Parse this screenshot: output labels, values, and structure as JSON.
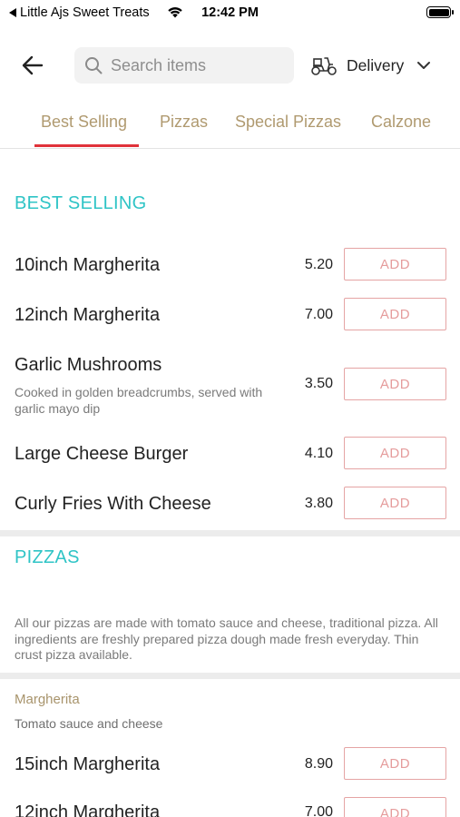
{
  "status_bar": {
    "back_app": "Little Ajs Sweet Treats",
    "time": "12:42 PM"
  },
  "header": {
    "search_placeholder": "Search items",
    "delivery_label": "Delivery"
  },
  "tabs": [
    {
      "label": "Best Selling",
      "active": true
    },
    {
      "label": "Pizzas",
      "active": false
    },
    {
      "label": "Special Pizzas",
      "active": false
    },
    {
      "label": "Calzone",
      "active": false
    }
  ],
  "best_selling": {
    "title": "BEST SELLING",
    "items": [
      {
        "name": "10inch Margherita",
        "price": "5.20",
        "add_label": "ADD"
      },
      {
        "name": "12inch Margherita",
        "price": "7.00",
        "add_label": "ADD"
      },
      {
        "name": "Garlic Mushrooms",
        "description": "Cooked in golden breadcrumbs, served with garlic mayo dip",
        "price": "3.50",
        "add_label": "ADD"
      },
      {
        "name": "Large Cheese Burger",
        "price": "4.10",
        "add_label": "ADD"
      },
      {
        "name": "Curly Fries With Cheese",
        "price": "3.80",
        "add_label": "ADD"
      }
    ]
  },
  "pizzas": {
    "title": "PIZZAS",
    "intro": "All our pizzas are made with tomato sauce and cheese, traditional pizza. All ingredients are freshly prepared pizza dough made fresh everyday. Thin crust pizza available.",
    "subcategory": {
      "title": "Margherita",
      "description": "Tomato sauce and cheese",
      "items": [
        {
          "name": "15inch Margherita",
          "price": "8.90",
          "add_label": "ADD"
        },
        {
          "name": "12inch Margherita",
          "price": "7.00",
          "add_label": "ADD"
        }
      ]
    }
  },
  "colors": {
    "accent_teal": "#2fc4c6",
    "tab_gold": "#b09a70",
    "active_underline": "#e0323a",
    "add_button": "#e5a4a4"
  }
}
